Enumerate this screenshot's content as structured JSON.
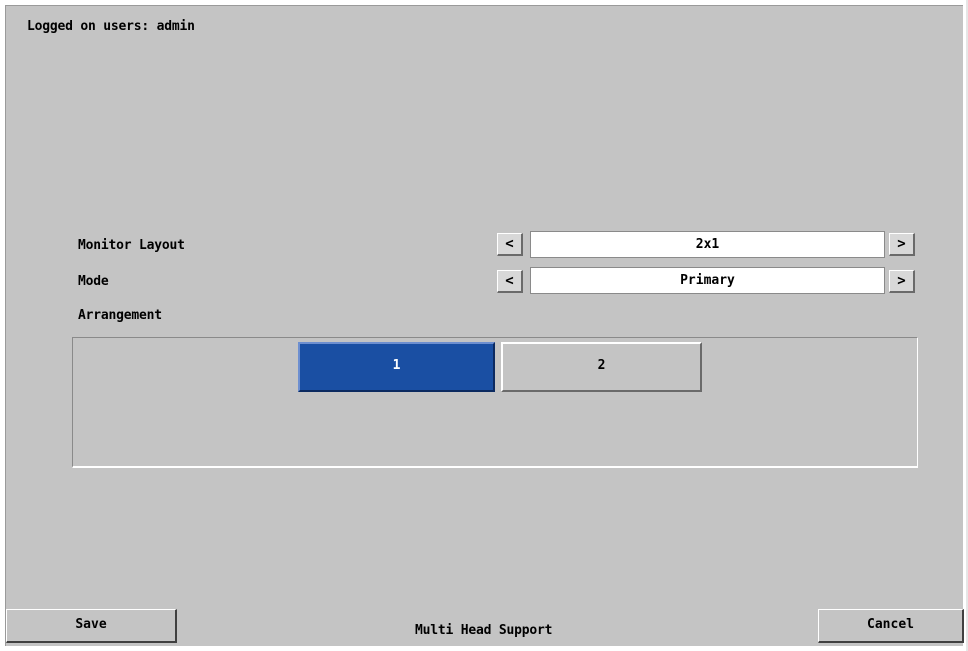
{
  "header": {
    "logged_on": "Logged on users: admin"
  },
  "settings": {
    "monitor_layout": {
      "label": "Monitor Layout",
      "value": "2x1",
      "prev": "<",
      "next": ">"
    },
    "mode": {
      "label": "Mode",
      "value": "Primary",
      "prev": "<",
      "next": ">"
    },
    "arrangement": {
      "label": "Arrangement",
      "monitors": [
        {
          "label": "1",
          "selected": true
        },
        {
          "label": "2",
          "selected": false
        }
      ]
    }
  },
  "footer": {
    "save_label": "Save",
    "title": "Multi Head Support",
    "cancel_label": "Cancel"
  },
  "colors": {
    "background": "#c4c4c4",
    "selected_monitor": "#1a4fa3",
    "field_background": "#ffffff"
  }
}
